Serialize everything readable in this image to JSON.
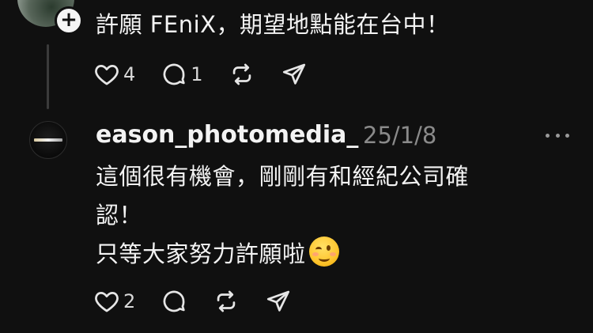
{
  "comments": [
    {
      "text": "許願 FEniX，期望地點能在台中！",
      "likes": "4",
      "replies": "1"
    },
    {
      "username": "eason_photomedia_",
      "date": "25/1/8",
      "lines": [
        "這個很有機會，剛剛有和經紀公司確",
        "認！",
        "只等大家努力許願啦"
      ],
      "emoji": "winking-face",
      "likes": "2"
    }
  ],
  "colors": {
    "background": "#101010",
    "text": "#f3f3f3",
    "muted": "#8a8a8a",
    "thread_line": "#3b3b3b"
  },
  "icons": [
    "plus-icon",
    "heart-icon",
    "comment-icon",
    "repost-icon",
    "share-icon",
    "more-icon"
  ]
}
